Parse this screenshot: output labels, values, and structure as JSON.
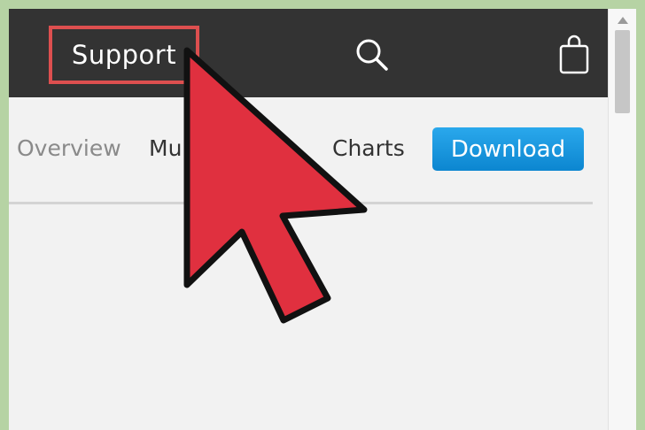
{
  "header": {
    "support_label": "Support",
    "search_icon": "search-icon",
    "bag_icon": "shopping-bag-icon",
    "background_color": "#333333",
    "highlight_color": "#dd4f4f"
  },
  "subnav": {
    "items": [
      {
        "label": "Overview",
        "state": "current"
      },
      {
        "label": "Mu",
        "state": "default"
      },
      {
        "label": "Charts",
        "state": "default"
      }
    ],
    "download_label": "Download",
    "download_color": "#1a96de"
  },
  "overlay": {
    "cursor_icon": "mouse-pointer-arrow-icon",
    "cursor_color": "#e0303f"
  },
  "frame": {
    "background_color": "#b6d3a4",
    "page_color": "#f2f2f2"
  }
}
